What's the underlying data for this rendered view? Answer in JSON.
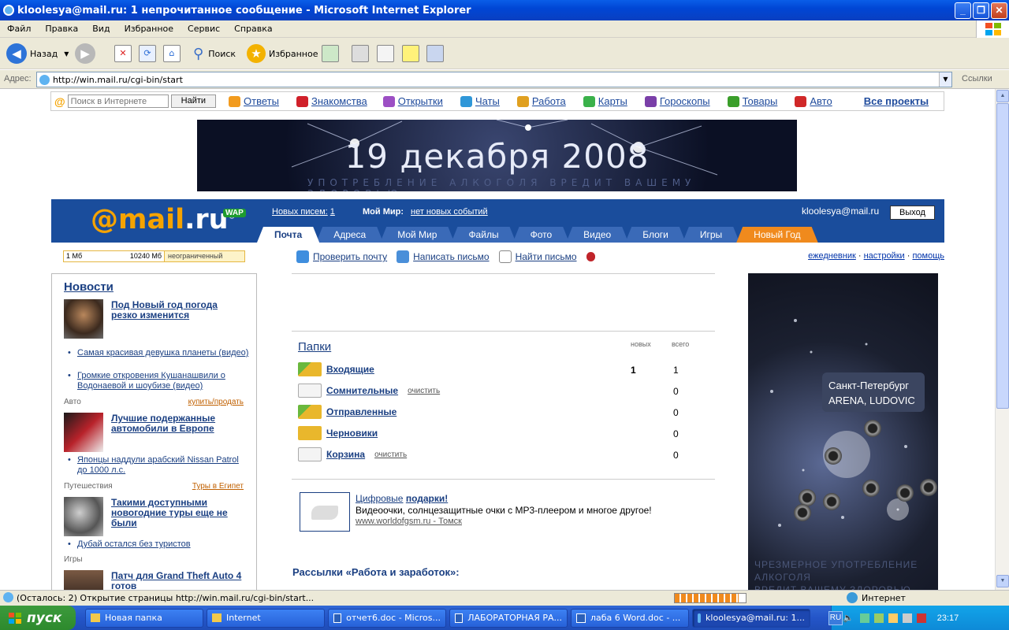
{
  "window": {
    "title": "kloolesya@mail.ru: 1 непрочитанное сообщение - Microsoft Internet Explorer"
  },
  "menu": [
    "Файл",
    "Правка",
    "Вид",
    "Избранное",
    "Сервис",
    "Справка"
  ],
  "toolbar": {
    "back": "Назад",
    "search": "Поиск",
    "favorites": "Избранное"
  },
  "address": {
    "label": "Адрес:",
    "url": "http://win.mail.ru/cgi-bin/start",
    "links": "Ссылки"
  },
  "topnav": {
    "search_placeholder": "Поиск в Интернете",
    "search_button": "Найти",
    "items": [
      {
        "label": "Ответы",
        "color": "#f29b1e"
      },
      {
        "label": "Знакомства",
        "color": "#d0202a"
      },
      {
        "label": "Открытки",
        "color": "#9c4fc4"
      },
      {
        "label": "Чаты",
        "color": "#2f97d8"
      },
      {
        "label": "Работа",
        "color": "#e0a020"
      },
      {
        "label": "Карты",
        "color": "#3ab14a"
      },
      {
        "label": "Гороскопы",
        "color": "#7a3fa8"
      },
      {
        "label": "Товары",
        "color": "#3a9e2a"
      },
      {
        "label": "Авто",
        "color": "#d02828"
      }
    ],
    "all_projects": "Все проекты"
  },
  "banner": {
    "date": "19 декабря 2008",
    "warning": "УПОТРЕБЛЕНИЕ АЛКОГОЛЯ ВРЕДИТ ВАШЕМУ ЗДОРОВЬЮ"
  },
  "mail_header": {
    "logo_at": "@mail",
    "logo_ru": ".ru",
    "registered": "®",
    "wap": "WAP",
    "new_letters_label": "Новых писем:",
    "new_letters_count": "1",
    "my_world_label": "Мой Мир:",
    "my_world_value": "нет новых событий",
    "user": "kloolesya@mail.ru",
    "exit": "Выход",
    "tabs": [
      "Почта",
      "Адреса",
      "Мой Мир",
      "Файлы",
      "Фото",
      "Видео",
      "Блоги",
      "Игры",
      "Новый Год"
    ]
  },
  "quota": {
    "used": "1 Мб",
    "total": "10240 Мб",
    "rest": "неограниченный"
  },
  "actions": [
    "Проверить почту",
    "Написать письмо",
    "Найти письмо"
  ],
  "right_links": [
    "ежедневник",
    "настройки",
    "помощь"
  ],
  "news": {
    "title": "Новости",
    "lead": "Под Новый год погода резко изменится",
    "items": [
      "Самая красивая девушка планеты (видео)",
      "Громкие откровения Кушанашвили о Водонаевой и шоубизе (видео)"
    ],
    "auto_section": "Авто",
    "auto_link": "купить/продать",
    "auto_lead": "Лучшие подержанные автомобили в Европе",
    "auto_item": "Японцы наддули арабский Nissan Patrol до 1000 л.с.",
    "travel_section": "Путешествия",
    "travel_link": "Туры в Египет",
    "travel_lead": "Такими доступными новогодние туры еще не были",
    "travel_item": "Дубай остался без туристов",
    "games_section": "Игры",
    "games_lead": "Патч для Grand Theft Auto 4 готов"
  },
  "folders": {
    "title": "Папки",
    "col_new": "новых",
    "col_total": "всего",
    "rows": [
      {
        "name": "Входящие",
        "new": "1",
        "total": "1",
        "clear": "",
        "color": "#e9b72c"
      },
      {
        "name": "Сомнительные",
        "new": "",
        "total": "0",
        "clear": "очистить",
        "color": "#eeeeee"
      },
      {
        "name": "Отправленные",
        "new": "",
        "total": "0",
        "clear": "",
        "color": "#e9b72c"
      },
      {
        "name": "Черновики",
        "new": "",
        "total": "0",
        "clear": "",
        "color": "#e9b72c"
      },
      {
        "name": "Корзина",
        "new": "",
        "total": "0",
        "clear": "очистить",
        "color": "#eeeeee"
      }
    ]
  },
  "promo": {
    "title_a": "Цифровые",
    "title_b": "подарки!",
    "text": "Видеоочки, солнцезащитные очки с МР3-плеером и многое другое!",
    "url": "www.worldofgsm.ru - Томск"
  },
  "newsletter": "Рассылки «Работа и заработок»:",
  "ad": {
    "city": "Санкт-Петербург",
    "venue": "ARENA, LUDOVIC",
    "footer1": "ЧРЕЗМЕРНОЕ УПОТРЕБЛЕНИЕ АЛКОГОЛЯ",
    "footer2": "ВРЕДИТ ВАШЕМУ ЗДОРОВЬЮ"
  },
  "status": {
    "text": "(Осталось: 2) Открытие страницы http://win.mail.ru/cgi-bin/start...",
    "zone": "Интернет",
    "progress": 0.9
  },
  "taskbar": {
    "start": "пуск",
    "tasks": [
      "Новая папка",
      "Internet",
      "отчет6.doc - Micros...",
      "ЛАБОРАТОРНАЯ РА...",
      "лаба 6 Word.doc - ...",
      "kloolesya@mail.ru: 1..."
    ],
    "lang": "RU",
    "clock": "23:17"
  }
}
